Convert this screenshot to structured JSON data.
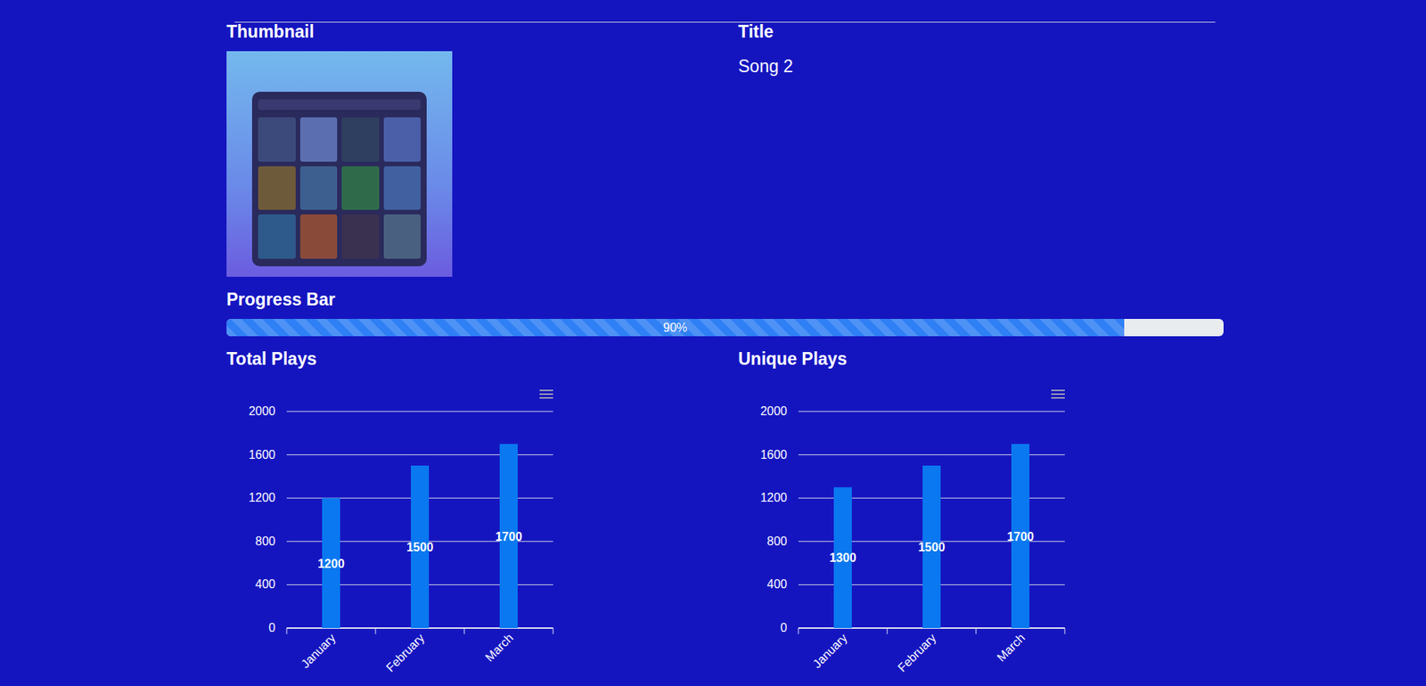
{
  "thumbnail": {
    "label": "Thumbnail"
  },
  "title": {
    "label": "Title",
    "value": "Song 2"
  },
  "progress": {
    "label": "Progress Bar",
    "level": 0.9,
    "text": "90%"
  },
  "charts": [
    {
      "title": "Total Plays",
      "y_ticks": [
        "0",
        "400",
        "800",
        "1200",
        "1600",
        "2000"
      ],
      "categories": [
        "January",
        "February",
        "March"
      ],
      "values": [
        1200,
        1500,
        1700
      ],
      "value_labels": [
        "1200",
        "1500",
        "1700"
      ]
    },
    {
      "title": "Unique Plays",
      "y_ticks": [
        "0",
        "400",
        "800",
        "1200",
        "1600",
        "2000"
      ],
      "categories": [
        "January",
        "February",
        "March"
      ],
      "values": [
        1300,
        1500,
        1700
      ],
      "value_labels": [
        "1300",
        "1500",
        "1700"
      ]
    }
  ]
}
